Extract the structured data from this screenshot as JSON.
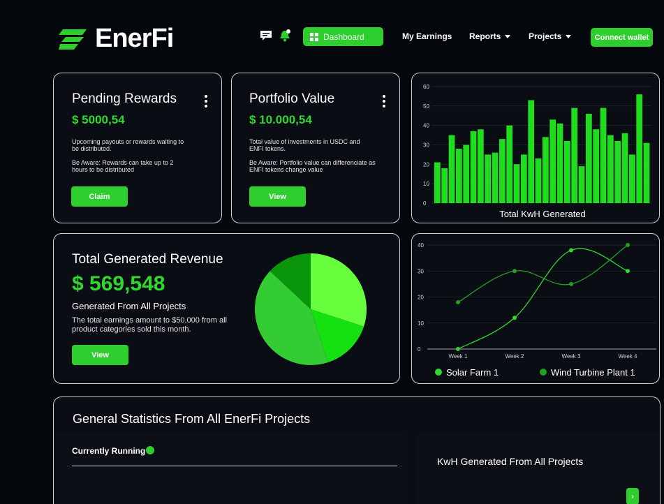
{
  "brand": {
    "name": "EnerFi"
  },
  "header": {
    "dashboard_label": "Dashboard",
    "nav": [
      {
        "label": "My Earnings"
      },
      {
        "label": "Reports"
      },
      {
        "label": "Projects"
      }
    ],
    "connect_label": "Connect wallet"
  },
  "pending": {
    "title": "Pending Rewards",
    "amount": "$ 5000,54",
    "desc1": "Upcoming payouts or rewards waiting to be distributed.",
    "desc2": "Be Aware: Rewards can take up to 2 hours to be distributed",
    "button": "Claim"
  },
  "portfolio": {
    "title": "Portfolio Value",
    "amount": "$ 10.000,54",
    "desc1": "Total value of investments in USDC and ENFI tokens.",
    "desc2": "Be Aware: Portfolio value can differenciate as ENFI tokens change value",
    "button": "View"
  },
  "revenue": {
    "title": "Total Generated Revenue",
    "amount": "$ 569,548",
    "subtitle": "Generated From All Projects",
    "desc": "The total earnings amount to $50,000 from all product categories sold this month.",
    "button": "View"
  },
  "stats": {
    "title": "General Statistics From All EnerFi Projects",
    "running_label": "Currently Running",
    "kwh_title": "KwH Generated From All Projects"
  },
  "colors": {
    "accent": "#2fce2f",
    "bar": "#1fdc1f",
    "solar": "#2ed82e",
    "wind": "#23a023"
  },
  "chart_data": [
    {
      "type": "bar",
      "title": "Total KwH Generated",
      "ylim": [
        0,
        60
      ],
      "yticks": [
        0,
        10,
        20,
        30,
        40,
        50,
        60
      ],
      "values": [
        21,
        18,
        35,
        28,
        30,
        37,
        38,
        25,
        26,
        33,
        40,
        20,
        25,
        53,
        23,
        34,
        43,
        41,
        32,
        49,
        19,
        46,
        38,
        49,
        35,
        32,
        36,
        25,
        56,
        31
      ]
    },
    {
      "type": "pie",
      "values": [
        30,
        15,
        42,
        13
      ],
      "colors": [
        "#66ff3c",
        "#14e012",
        "#33cc33",
        "#0a960a"
      ]
    },
    {
      "type": "line",
      "categories": [
        "Week 1",
        "Week 2",
        "Week 3",
        "Week 4"
      ],
      "ylim": [
        0,
        40
      ],
      "yticks": [
        0,
        10,
        20,
        30,
        40
      ],
      "series": [
        {
          "name": "Solar Farm 1",
          "values": [
            0,
            12,
            38,
            30
          ]
        },
        {
          "name": "Wind Turbine Plant 1",
          "values": [
            18,
            30,
            25,
            40
          ]
        }
      ]
    }
  ]
}
